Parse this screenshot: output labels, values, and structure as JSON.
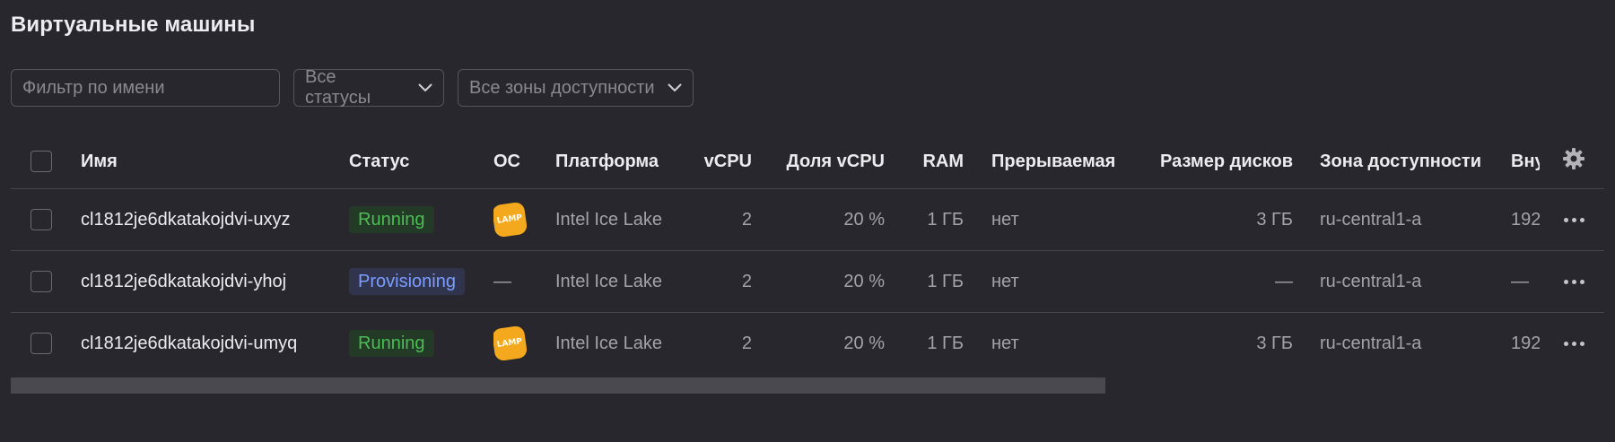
{
  "page_title": "Виртуальные машины",
  "filters": {
    "name_placeholder": "Фильтр по имени",
    "name_value": "",
    "status_select": "Все статусы",
    "zone_select": "Все зоны доступности"
  },
  "table": {
    "headers": {
      "name": "Имя",
      "status": "Статус",
      "os": "ОС",
      "platform": "Платформа",
      "vcpu": "vCPU",
      "vcpu_share": "Доля vCPU",
      "ram": "RAM",
      "preemptible": "Прерываемая",
      "disk_size": "Размер дисков",
      "zone": "Зона доступности",
      "internal": "Вну"
    },
    "rows": [
      {
        "name": "cl1812je6dkatakojdvi-uxyz",
        "status": "Running",
        "os_icon": "lamp-icon",
        "os_label": "LAMP",
        "platform": "Intel Ice Lake",
        "vcpu": "2",
        "vcpu_share": "20 %",
        "ram": "1 ГБ",
        "preemptible": "нет",
        "disk_size": "3 ГБ",
        "zone": "ru-central1-a",
        "internal": "192"
      },
      {
        "name": "cl1812je6dkatakojdvi-yhoj",
        "status": "Provisioning",
        "os_label": "—",
        "platform": "Intel Ice Lake",
        "vcpu": "2",
        "vcpu_share": "20 %",
        "ram": "1 ГБ",
        "preemptible": "нет",
        "disk_size": "—",
        "zone": "ru-central1-a",
        "internal": "—"
      },
      {
        "name": "cl1812je6dkatakojdvi-umyq",
        "status": "Running",
        "os_icon": "lamp-icon",
        "os_label": "LAMP",
        "platform": "Intel Ice Lake",
        "vcpu": "2",
        "vcpu_share": "20 %",
        "ram": "1 ГБ",
        "preemptible": "нет",
        "disk_size": "3 ГБ",
        "zone": "ru-central1-a",
        "internal": "192"
      }
    ]
  },
  "colors": {
    "background": "#28272d",
    "running_text": "#4cbc55",
    "running_bg": "#233a26",
    "provisioning_text": "#7c9dff",
    "provisioning_bg": "#30354d",
    "lamp_icon": "#f4a81d"
  }
}
